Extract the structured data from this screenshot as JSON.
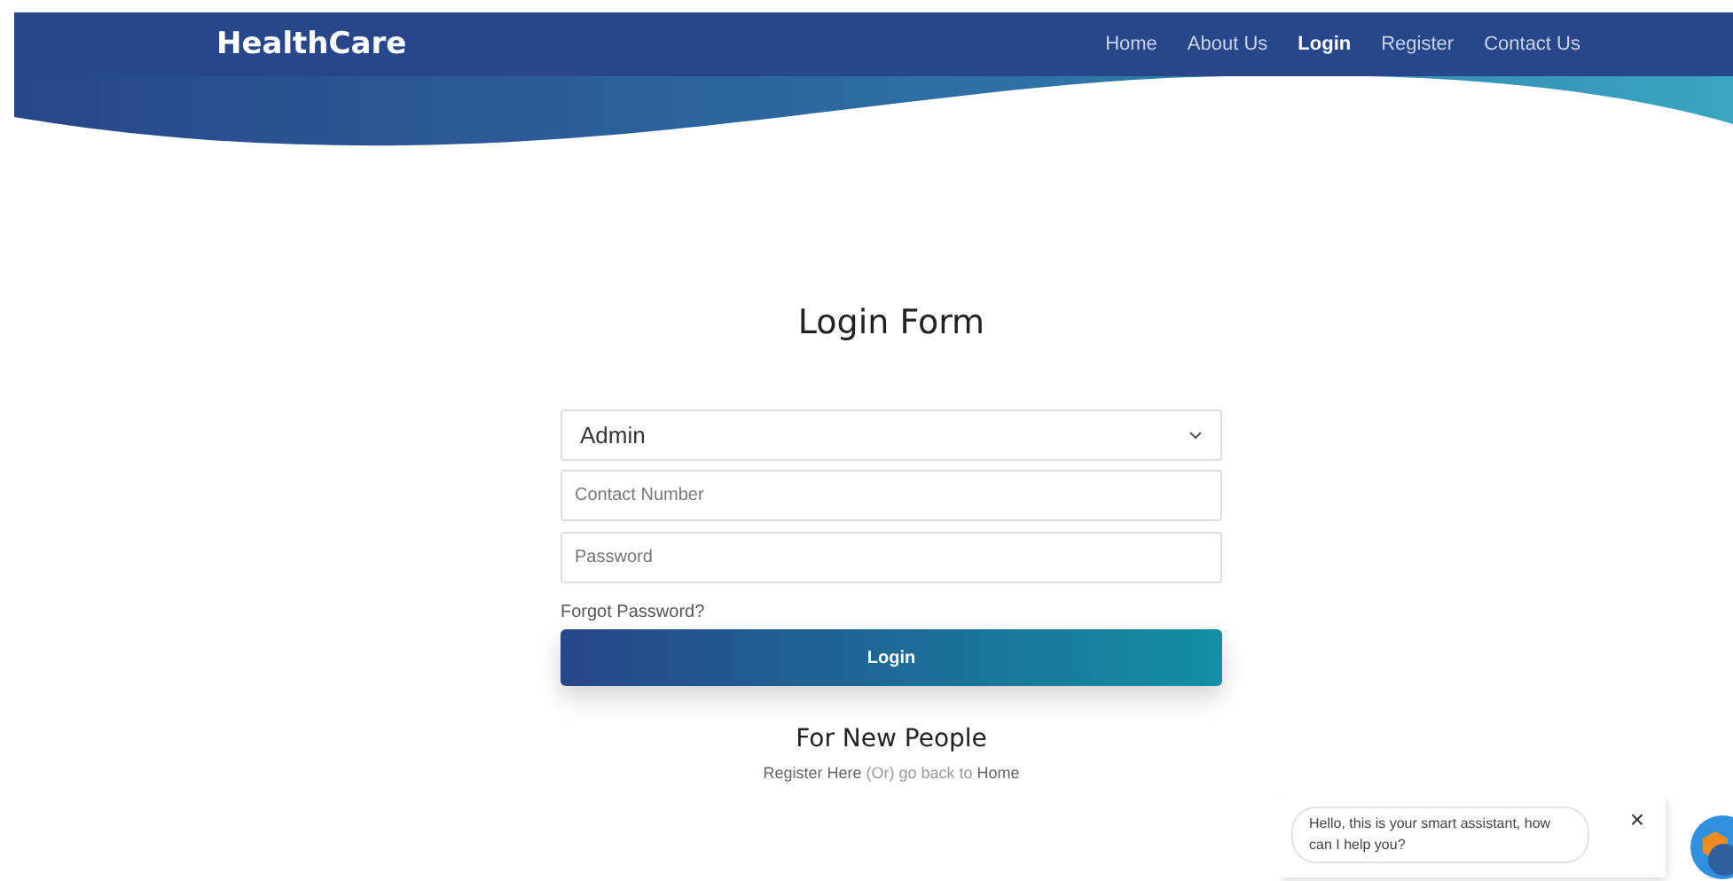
{
  "header": {
    "brand": "HealthCare",
    "nav": [
      {
        "label": "Home",
        "selected": false
      },
      {
        "label": "About Us",
        "selected": false
      },
      {
        "label": "Login",
        "selected": true
      },
      {
        "label": "Register",
        "selected": false
      },
      {
        "label": "Contact Us",
        "selected": false
      }
    ]
  },
  "form": {
    "title": "Login Form",
    "role_select": {
      "value": "Admin"
    },
    "contact_field": {
      "placeholder": "Contact Number"
    },
    "password_field": {
      "placeholder": "Password"
    },
    "forgot_link": "Forgot Password?",
    "submit_button": "Login"
  },
  "new_people": {
    "heading": "For New People",
    "register_link": "Register Here",
    "middle_text": " (Or) go back to ",
    "home_link": "Home"
  },
  "chat": {
    "message": "Hello, this is your smart assistant, how can I help you?",
    "close": "×"
  }
}
